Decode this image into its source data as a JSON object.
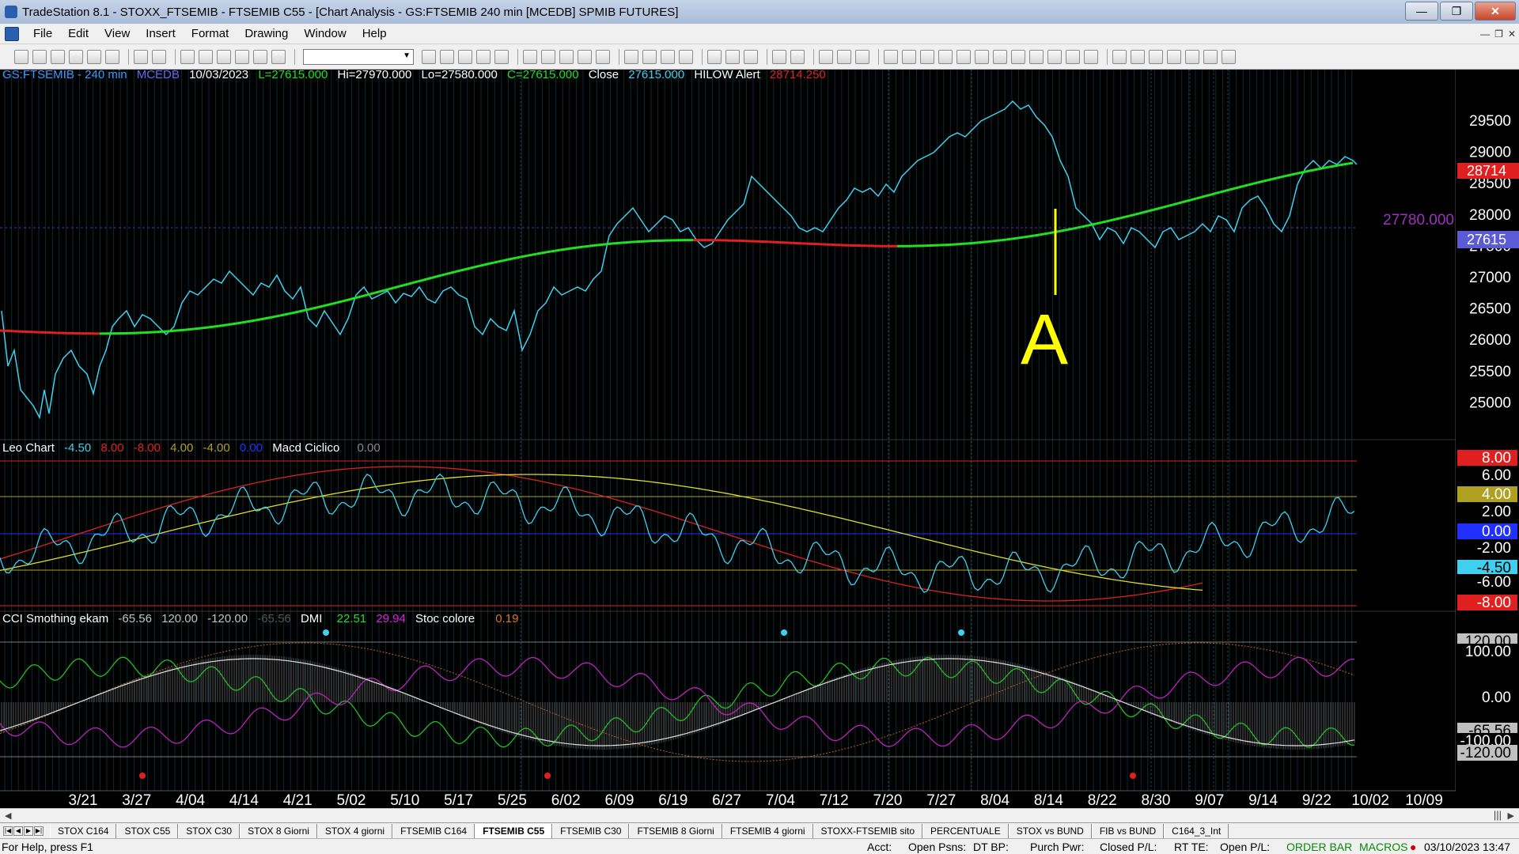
{
  "window": {
    "title": "TradeStation 8.1 - STOXX_FTSEMIB - FTSEMIB C55 - [Chart Analysis - GS:FTSEMIB  240 min  [MCEDB] SPMIB FUTURES]",
    "minimize": "—",
    "maximize": "❐",
    "close": "✕"
  },
  "menu": [
    "File",
    "Edit",
    "View",
    "Insert",
    "Format",
    "Drawing",
    "Window",
    "Help"
  ],
  "header": {
    "symbol": "GS:FTSEMIB - 240 min",
    "source": "MCEDB",
    "date": "10/03/2023",
    "low_last": "L=27615.000",
    "hi": "Hi=27970.000",
    "lo": "Lo=27580.000",
    "close_eq": "C=27615.000",
    "close_label": "Close",
    "close_value": "27615.000",
    "alert_label": "HILOW Alert",
    "alert_value": "28714.250"
  },
  "price_panel": {
    "axis_ticks": [
      "29500",
      "29000",
      "28500",
      "28000",
      "27500",
      "27000",
      "26500",
      "26000",
      "25500",
      "25000"
    ],
    "line_label": "27780.000",
    "badge_alert": "28714",
    "badge_last": "27615",
    "annotation_letter": "A"
  },
  "leo_panel": {
    "name": "Leo Chart",
    "v1": "-4.50",
    "v2": "8.00",
    "v3": "-8.00",
    "v4": "4.00",
    "v5": "-4.00",
    "v6": "0.00",
    "macd_name": "Macd Ciclico",
    "macd_value": "0.00",
    "axis_ticks": [
      "8.00",
      "6.00",
      "4.00",
      "2.00",
      "0.00",
      "-2.00",
      "-4.50",
      "-6.00",
      "-8.00"
    ]
  },
  "cci_panel": {
    "name": "CCI Smothing ekam",
    "v1": "-65.56",
    "v2": "120.00",
    "v3": "-120.00",
    "v4": "-65.56",
    "dmi_name": "DMI",
    "dmi_v1": "22.51",
    "dmi_v2": "29.94",
    "stoc_name": "Stoc colore",
    "stoc_value": "0.19",
    "axis_ticks": [
      "120.00",
      "100.00",
      "0.00",
      "-65.56",
      "-100.00",
      "-120.00"
    ]
  },
  "x_axis": [
    "3/21",
    "3/27",
    "4/04",
    "4/14",
    "4/21",
    "5/02",
    "5/10",
    "5/17",
    "5/25",
    "6/02",
    "6/09",
    "6/19",
    "6/27",
    "7/04",
    "7/12",
    "7/20",
    "7/27",
    "8/04",
    "8/14",
    "8/22",
    "8/30",
    "9/07",
    "9/14",
    "9/22",
    "10/02",
    "10/09"
  ],
  "tabs": [
    "STOX C164",
    "STOX C55",
    "STOX C30",
    "STOX 8 Giorni",
    "STOX 4 giorni",
    "FTSEMIB C164",
    "FTSEMIB C55",
    "FTSEMIB C30",
    "FTSEMIB 8 Giorni",
    "FTSEMIB 4 giorni",
    "STOXX-FTSEMIB sito",
    "PERCENTUALE",
    "STOX vs BUND",
    "FIB vs BUND",
    "C164_3_Int"
  ],
  "active_tab": "FTSEMIB C55",
  "status": {
    "help": "For Help, press F1",
    "acct": "Acct:",
    "open_psns": "Open Psns:",
    "dt_bp": "DT BP:",
    "purch_pwr": "Purch Pwr:",
    "closed_pl": "Closed P/L:",
    "rt_te": "RT TE:",
    "open_pl": "Open P/L:",
    "order_bar": "ORDER BAR",
    "macros": "MACROS",
    "datetime": "03/10/2023 13:47"
  },
  "colors": {
    "price": "#3fd0f0",
    "ma_up": "#22e022",
    "ma_down": "#e02020",
    "annotation": "#ffff00",
    "axis_text": "#ffffff"
  },
  "icons": [
    "new-icon",
    "open-icon",
    "save-icon",
    "print-icon",
    "zoom-in-icon",
    "zoom-out-icon",
    "cursor-icon",
    "trendline-icon",
    "text-icon"
  ]
}
